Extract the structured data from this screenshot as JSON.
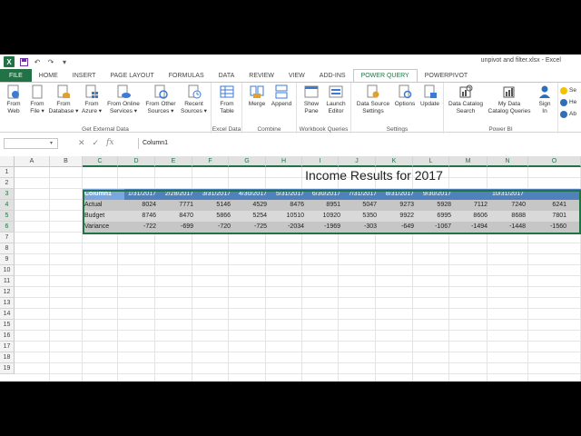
{
  "window": {
    "title": "unpivot and filter.xlsx - Excel",
    "app_logo": "X"
  },
  "qat": [
    "save-icon",
    "undo-icon",
    "redo-icon",
    "customize-icon"
  ],
  "tabs": [
    {
      "label": "FILE"
    },
    {
      "label": "HOME"
    },
    {
      "label": "INSERT"
    },
    {
      "label": "PAGE LAYOUT"
    },
    {
      "label": "FORMULAS"
    },
    {
      "label": "DATA"
    },
    {
      "label": "REVIEW"
    },
    {
      "label": "VIEW"
    },
    {
      "label": "ADD-INS"
    },
    {
      "label": "POWER QUERY"
    },
    {
      "label": "POWERPIVOT"
    }
  ],
  "ribbon": {
    "groups": [
      {
        "label": "Get External Data",
        "buttons": [
          {
            "label1": "From",
            "label2": "Web"
          },
          {
            "label1": "From",
            "label2": "File ▾"
          },
          {
            "label1": "From",
            "label2": "Database ▾"
          },
          {
            "label1": "From",
            "label2": "Azure ▾"
          },
          {
            "label1": "From Online",
            "label2": "Services ▾"
          },
          {
            "label1": "From Other",
            "label2": "Sources ▾"
          },
          {
            "label1": "Recent",
            "label2": "Sources ▾"
          }
        ]
      },
      {
        "label": "Excel Data",
        "buttons": [
          {
            "label1": "From",
            "label2": "Table"
          }
        ]
      },
      {
        "label": "Combine",
        "buttons": [
          {
            "label1": "Merge",
            "label2": ""
          },
          {
            "label1": "Append",
            "label2": ""
          }
        ]
      },
      {
        "label": "Workbook Queries",
        "buttons": [
          {
            "label1": "Show",
            "label2": "Pane"
          },
          {
            "label1": "Launch",
            "label2": "Editor"
          }
        ]
      },
      {
        "label": "Settings",
        "buttons": [
          {
            "label1": "Data Source",
            "label2": "Settings"
          },
          {
            "label1": "Options",
            "label2": ""
          },
          {
            "label1": "Update",
            "label2": ""
          }
        ]
      },
      {
        "label": "Power BI",
        "buttons": [
          {
            "label1": "Data Catalog",
            "label2": "Search"
          },
          {
            "label1": "My Data",
            "label2": "Catalog Queries"
          },
          {
            "label1": "Sign",
            "label2": "In"
          }
        ]
      }
    ],
    "side_items": [
      "Se",
      "He",
      "Ab"
    ]
  },
  "formula_bar": {
    "name_box": "",
    "fx": "fx",
    "content": "Column1"
  },
  "columns": [
    "A",
    "B",
    "C",
    "D",
    "E",
    "F",
    "G",
    "H",
    "I",
    "J",
    "K",
    "L",
    "M",
    "N",
    "O"
  ],
  "rows": [
    "1",
    "2",
    "3",
    "4",
    "5",
    "6",
    "7",
    "8",
    "9",
    "10",
    "11",
    "12",
    "13",
    "14",
    "15",
    "16",
    "17",
    "18",
    "19"
  ],
  "sheet": {
    "title": "Income Results for 2017",
    "table_header": [
      "Column1",
      "1/31/2017",
      "2/28/2017",
      "3/31/2017",
      "4/30/2017",
      "5/31/2017",
      "6/30/2017",
      "7/31/2017",
      "8/31/2017",
      "9/30/2017",
      "10/31/2017"
    ],
    "table_rows": [
      [
        "Actual",
        "8024",
        "7771",
        "5146",
        "4529",
        "8476",
        "8951",
        "5047",
        "9273",
        "5928",
        "7112",
        "7240",
        "6241"
      ],
      [
        "Budget",
        "8746",
        "8470",
        "5866",
        "5254",
        "10510",
        "10920",
        "5350",
        "9922",
        "6995",
        "8606",
        "8688",
        "7801"
      ],
      [
        "Variance",
        "-722",
        "-699",
        "-720",
        "-725",
        "-2034",
        "-1969",
        "-303",
        "-649",
        "-1067",
        "-1494",
        "-1448",
        "-1560"
      ]
    ]
  },
  "colors": {
    "accent": "#217346",
    "table_header": "#4f81bd",
    "table_band1": "#c6c6c6",
    "table_band2": "#d9d9d9"
  }
}
